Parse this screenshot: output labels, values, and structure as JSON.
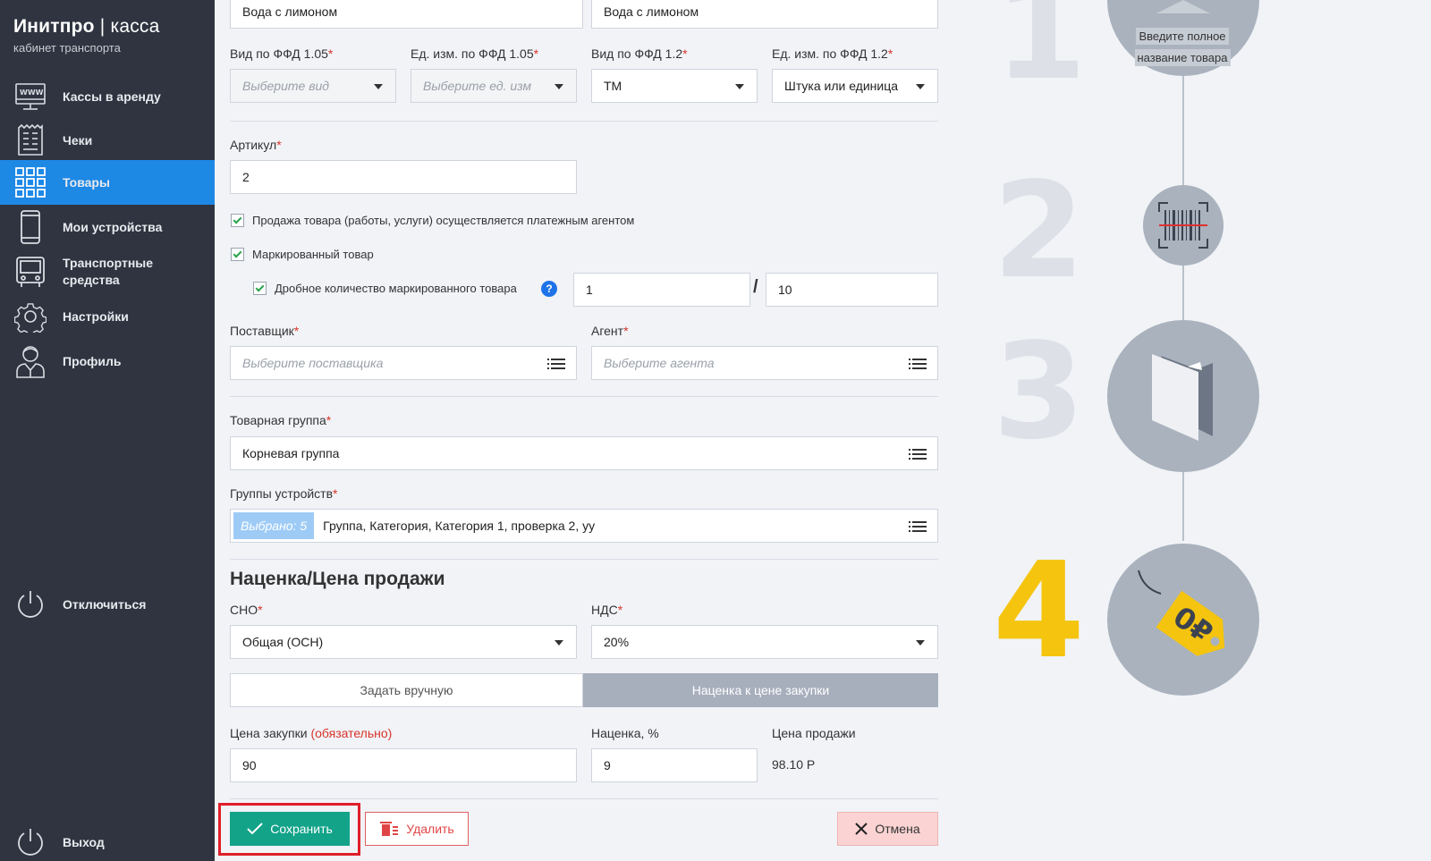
{
  "brand": {
    "title_bold": "Инитпро",
    "title_sep": "|",
    "title_light": "касса",
    "subtitle": "кабинет транспорта"
  },
  "sidebar": {
    "items": [
      {
        "label": "Кассы в аренду",
        "icon": "www-monitor-icon"
      },
      {
        "label": "Чеки",
        "icon": "receipt-icon"
      },
      {
        "label": "Товары",
        "icon": "grid-icon",
        "active": true
      },
      {
        "label": "Мои устройства",
        "icon": "phone-icon"
      },
      {
        "label": "Транспортные средства",
        "icon": "bus-icon"
      },
      {
        "label": "Настройки",
        "icon": "gear-icon"
      },
      {
        "label": "Профиль",
        "icon": "user-icon"
      }
    ],
    "disconnect": "Отключиться",
    "logout": "Выход"
  },
  "form": {
    "name_left": "Вода с лимоном",
    "name_right": "Вода с лимоном",
    "ffd105_type": {
      "label": "Вид по ФФД 1.05",
      "placeholder": "Выберите вид"
    },
    "ffd105_unit": {
      "label": "Ед. изм. по ФФД 1.05",
      "placeholder": "Выберите ед. изм"
    },
    "ffd12_type": {
      "label": "Вид по ФФД 1.2",
      "value": "ТМ"
    },
    "ffd12_unit": {
      "label": "Ед. изм. по ФФД 1.2",
      "value": "Штука или единица"
    },
    "article": {
      "label": "Артикул",
      "value": "2"
    },
    "agent_sale": "Продажа товара (работы, услуги) осуществляется платежным агентом",
    "marked": "Маркированный товар",
    "fractional": {
      "label": "Дробное количество маркированного товара",
      "numerator": "1",
      "slash": "/",
      "denominator": "10",
      "help": "?"
    },
    "supplier": {
      "label": "Поставщик",
      "placeholder": "Выберите поставщика"
    },
    "agent": {
      "label": "Агент",
      "placeholder": "Выберите агента"
    },
    "product_group": {
      "label": "Товарная группа",
      "value": "Корневая группа"
    },
    "device_groups": {
      "label": "Группы устройств",
      "badge": "Выбрано: 5",
      "value": "Группа, Категория, Категория 1, проверка 2, уу"
    }
  },
  "pricing": {
    "title": "Наценка/Цена продажи",
    "sno": {
      "label": "СНО",
      "value": "Общая (ОСН)"
    },
    "nds": {
      "label": "НДС",
      "value": "20%"
    },
    "mode_manual": "Задать вручную",
    "mode_markup": "Наценка к цене закупки",
    "purchase": {
      "label": "Цена закупки",
      "required_note": "(обязательно)",
      "value": "90"
    },
    "markup": {
      "label": "Наценка, %",
      "value": "9"
    },
    "sale": {
      "label": "Цена продажи",
      "value": "98.10 Р"
    }
  },
  "actions": {
    "save": "Сохранить",
    "delete": "Удалить",
    "cancel": "Отмена"
  },
  "steps": {
    "n1": "1",
    "n2": "2",
    "n3": "3",
    "n4": "4",
    "tooltip_line1": "Введите полное",
    "tooltip_line2": "название товара",
    "price_tag": "0₽"
  },
  "colors": {
    "sidebar_bg": "#2f3440",
    "active": "#1e88e5",
    "save": "#12a389",
    "accent_step": "#f5c40f"
  }
}
